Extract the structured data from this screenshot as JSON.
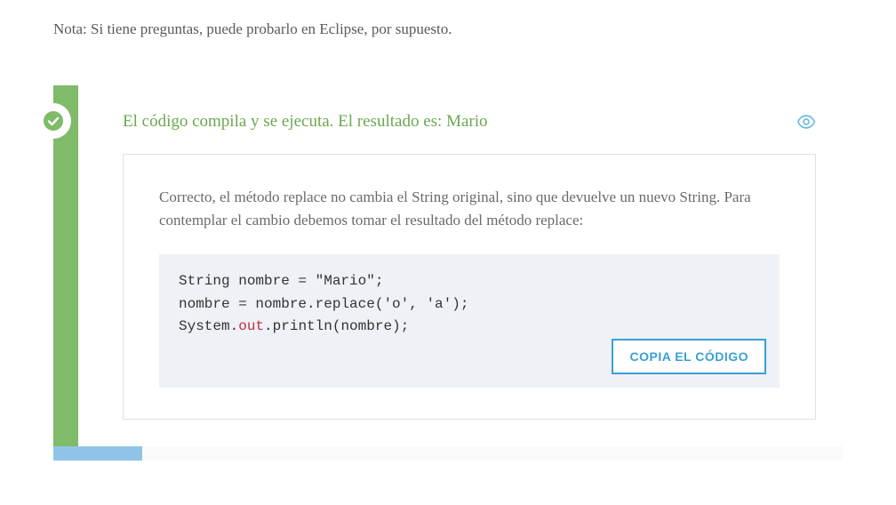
{
  "note": "Nota: Si tiene preguntas, puede probarlo en Eclipse, por supuesto.",
  "answer": {
    "title": "El código compila y se ejecuta. El resultado es: Mario",
    "explanation": "Correcto, el método replace no cambia el String original, sino que devuelve un nuevo String. Para contemplar el cambio debemos tomar el resultado del método replace:",
    "code": {
      "line1_a": "String nombre = ",
      "line1_b": "\"Mario\"",
      "line1_c": ";",
      "line2": "nombre = nombre.replace('o', 'a');",
      "line3_a": "System.",
      "line3_b": "out",
      "line3_c": ".println(nombre);"
    },
    "copyLabel": "COPIA EL CÓDIGO"
  },
  "colors": {
    "green": "#7fbb69",
    "greenText": "#6ba84f",
    "blue": "#3a9fd6",
    "lightBlue": "#8fc4e8"
  }
}
